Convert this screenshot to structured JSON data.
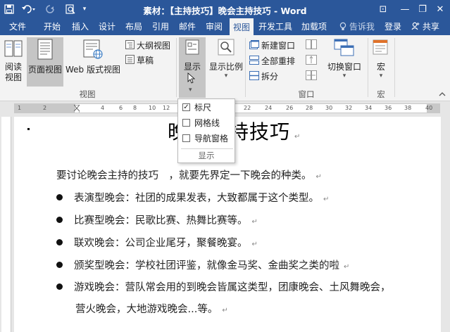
{
  "titlebar": {
    "title": "素材：【主持技巧】晚会主持技巧 - Word",
    "quick_access": [
      "save-icon",
      "undo-icon",
      "redo-icon",
      "print-preview-icon",
      "customize-icon"
    ],
    "window_controls": [
      "ribbon-display-icon",
      "minimize-icon",
      "restore-icon",
      "close-icon"
    ],
    "win_glyphs": [
      "⊡",
      "—",
      "❐",
      "✕"
    ]
  },
  "tabs": [
    {
      "label": "文件"
    },
    {
      "label": "开始"
    },
    {
      "label": "插入"
    },
    {
      "label": "设计"
    },
    {
      "label": "布局"
    },
    {
      "label": "引用"
    },
    {
      "label": "邮件"
    },
    {
      "label": "审阅"
    },
    {
      "label": "视图",
      "active": true
    },
    {
      "label": "开发工具"
    },
    {
      "label": "加载项"
    }
  ],
  "tell_me": "告诉我",
  "login": "登录",
  "share": "共享",
  "ribbon": {
    "view_group": {
      "label": "视图",
      "read_view": "阅读视图",
      "page_view": "页面视图",
      "web_view": "Web 版式视图",
      "outline": "大纲视图",
      "draft": "草稿"
    },
    "show": {
      "label": "显示"
    },
    "zoom": {
      "label": "显示比例"
    },
    "window_group": {
      "label": "窗口",
      "new_window": "新建窗口",
      "arrange_all": "全部重排",
      "split": "拆分",
      "switch_windows": "切换窗口"
    },
    "macro_group": {
      "label": "宏",
      "macro": "宏"
    }
  },
  "ruler_numbers": [
    "1",
    "2",
    "4",
    "6",
    "8",
    "10",
    "12",
    "14",
    "22",
    "24",
    "26",
    "28",
    "30",
    "32",
    "34",
    "36",
    "38",
    "40"
  ],
  "dropdown": {
    "items": [
      {
        "label": "标尺",
        "checked": true
      },
      {
        "label": "网格线",
        "checked": false
      },
      {
        "label": "导航窗格",
        "checked": false
      }
    ],
    "group_label": "显示"
  },
  "document": {
    "heading": "晚会主持技巧",
    "intro": "要讨论晚会主持的技巧　，就要先界定一下晚会的种类。",
    "bullets": [
      "表演型晚会：社团的成果发表，大致都属于这个类型。",
      "比赛型晚会：民歌比赛、热舞比赛等。",
      "联欢晚会：公司企业尾牙，聚餐晚宴。",
      "颁奖型晚会：学校社团评鉴，就像金马奖、金曲奖之类的啦",
      "游戏晚会：营队常会用的到晚会皆属这类型，团康晚会、土风舞晚会，"
    ],
    "continuation": "营火晚会，大地游戏晚会...等。",
    "paragraph_mark": "↵"
  }
}
